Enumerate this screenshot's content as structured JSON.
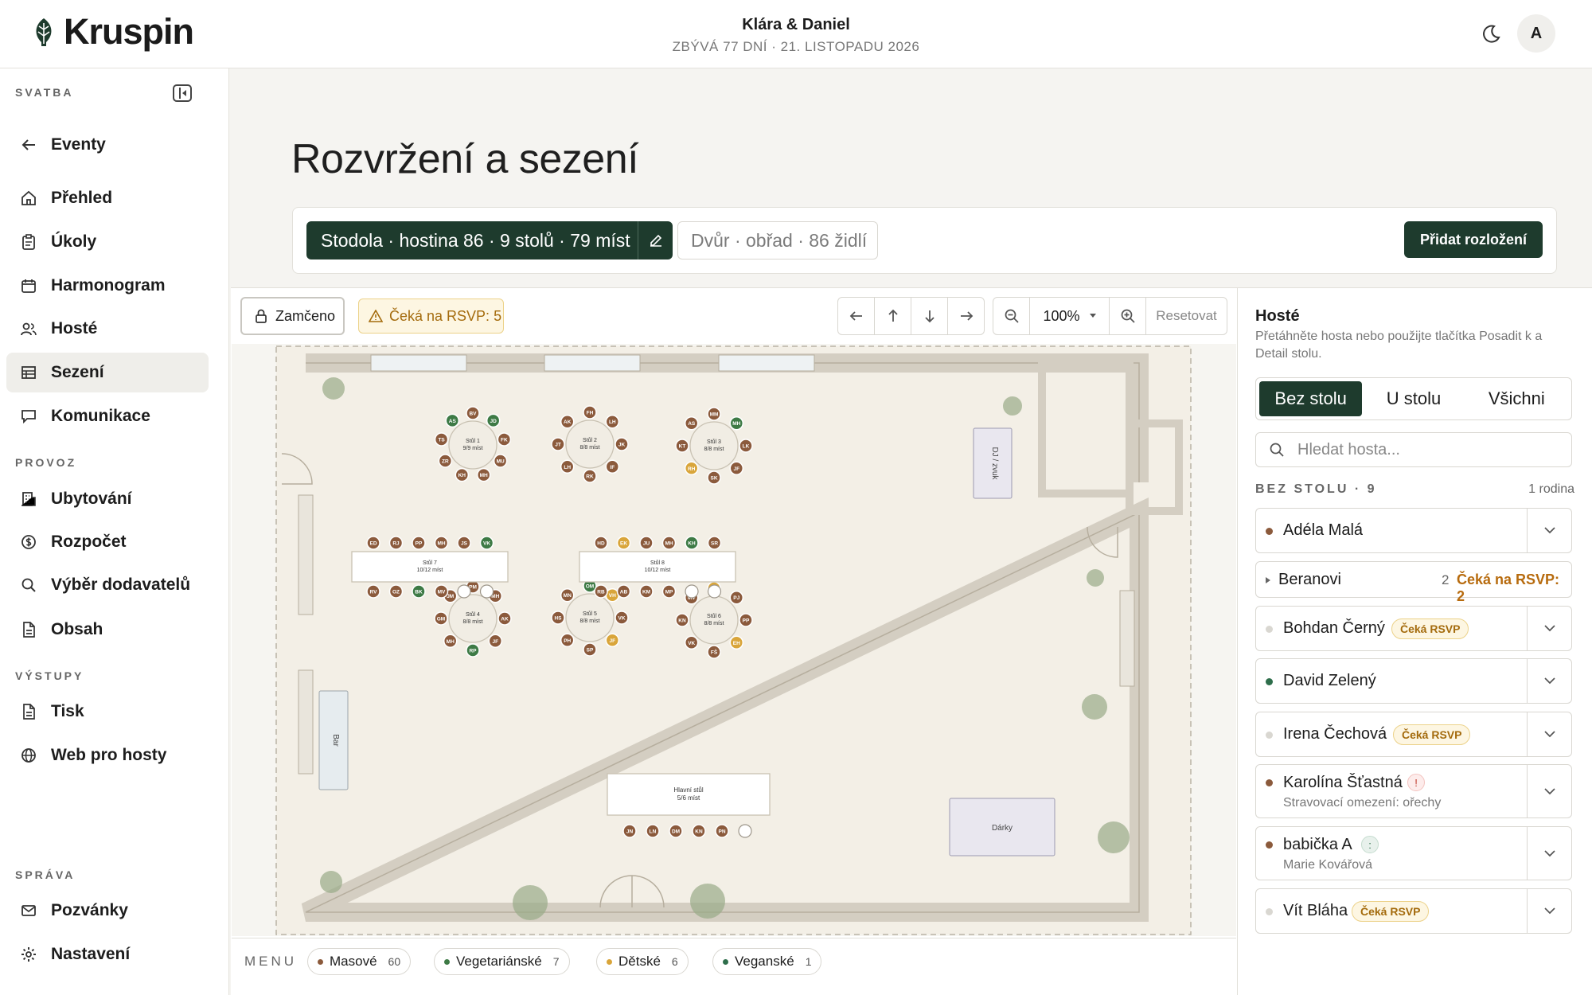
{
  "app": {
    "name": "Kruspin"
  },
  "header": {
    "couple": "Klára & Daniel",
    "countdown": "ZBÝVÁ 77 DNÍ · 21. LISTOPADU 2026",
    "avatar": "A"
  },
  "sidebar": {
    "sections": {
      "svatba": "SVATBA",
      "provoz": "PROVOZ",
      "vystupy": "VÝSTUPY",
      "sprava": "SPRÁVA"
    },
    "items": [
      {
        "label": "Eventy",
        "icon": "arrow-left-icon"
      },
      {
        "label": "Přehled",
        "icon": "home-icon"
      },
      {
        "label": "Úkoly",
        "icon": "clipboard-icon"
      },
      {
        "label": "Harmonogram",
        "icon": "calendar-icon"
      },
      {
        "label": "Hosté",
        "icon": "users-icon"
      },
      {
        "label": "Sezení",
        "icon": "table-icon",
        "active": true
      },
      {
        "label": "Komunikace",
        "icon": "chat-icon"
      },
      {
        "label": "Ubytování",
        "icon": "building-icon"
      },
      {
        "label": "Rozpočet",
        "icon": "coin-icon"
      },
      {
        "label": "Výběr dodavatelů",
        "icon": "search-icon"
      },
      {
        "label": "Obsah",
        "icon": "document-icon"
      },
      {
        "label": "Tisk",
        "icon": "print-icon"
      },
      {
        "label": "Web pro hosty",
        "icon": "globe-icon"
      },
      {
        "label": "Pozvánky",
        "icon": "mail-icon"
      },
      {
        "label": "Nastavení",
        "icon": "gear-icon"
      }
    ]
  },
  "page": {
    "title": "Rozvržení a sezení"
  },
  "layouts": {
    "active": "Stodola · hostina 86 · 9 stolů · 79 míst",
    "other": "Dvůr · obřad · 86 židlí",
    "add_label": "Přidat rozložení"
  },
  "toolbar": {
    "lock_label": "Zamčeno",
    "rsvp_warning": "Čeká na RSVP: 5",
    "zoom": "100%",
    "reset": "Resetovat"
  },
  "floorplan": {
    "colors": {
      "brown": "#8b5a3c",
      "green": "#3d7a45",
      "amber": "#d9a53a"
    },
    "round_tables": [
      {
        "name": "Stůl 1",
        "seats": "9/9 míst",
        "guests": [
          [
            "BV",
            "b"
          ],
          [
            "JD",
            "g"
          ],
          [
            "FK",
            "b"
          ],
          [
            "MU",
            "b"
          ],
          [
            "MH",
            "b"
          ],
          [
            "KH",
            "b"
          ],
          [
            "ZR",
            "b"
          ],
          [
            "TS",
            "b"
          ],
          [
            "AS",
            "g"
          ]
        ]
      },
      {
        "name": "Stůl 2",
        "seats": "8/8 míst",
        "guests": [
          [
            "FH",
            "b"
          ],
          [
            "LH",
            "b"
          ],
          [
            "JK",
            "b"
          ],
          [
            "IF",
            "b"
          ],
          [
            "RK",
            "b"
          ],
          [
            "LH",
            "b"
          ],
          [
            "JT",
            "b"
          ],
          [
            "AK",
            "b"
          ]
        ]
      },
      {
        "name": "Stůl 3",
        "seats": "8/8 míst",
        "guests": [
          [
            "MM",
            "b"
          ],
          [
            "MH",
            "g"
          ],
          [
            "LK",
            "b"
          ],
          [
            "JF",
            "b"
          ],
          [
            "SK",
            "b"
          ],
          [
            "RH",
            "a"
          ],
          [
            "KT",
            "b"
          ],
          [
            "AS",
            "b"
          ]
        ]
      },
      {
        "name": "Stůl 4",
        "seats": "8/8 míst",
        "guests": [
          [
            "PM",
            "b"
          ],
          [
            "MH",
            "b"
          ],
          [
            "AK",
            "b"
          ],
          [
            "JF",
            "b"
          ],
          [
            "RP",
            "g"
          ],
          [
            "MH",
            "b"
          ],
          [
            "GM",
            "b"
          ],
          [
            "JM",
            "b"
          ]
        ]
      },
      {
        "name": "Stůl 5",
        "seats": "8/8 míst",
        "guests": [
          [
            "OM",
            "g"
          ],
          [
            "VH",
            "a"
          ],
          [
            "VK",
            "b"
          ],
          [
            "JF",
            "a"
          ],
          [
            "SP",
            "b"
          ],
          [
            "PH",
            "b"
          ],
          [
            "HS",
            "b"
          ],
          [
            "MN",
            "b"
          ]
        ]
      },
      {
        "name": "Stůl 6",
        "seats": "8/8 míst",
        "guests": [
          [
            "BD",
            "a"
          ],
          [
            "PJ",
            "b"
          ],
          [
            "PP",
            "b"
          ],
          [
            "EH",
            "a"
          ],
          [
            "FŠ",
            "b"
          ],
          [
            "VK",
            "b"
          ],
          [
            "KN",
            "b"
          ],
          [
            "MV",
            "b"
          ]
        ]
      }
    ],
    "rect_tables": [
      {
        "name": "Stůl 7",
        "seats": "10/12 míst",
        "top": [
          [
            "ED",
            "b"
          ],
          [
            "RJ",
            "b"
          ],
          [
            "PP",
            "b"
          ],
          [
            "MH",
            "b"
          ],
          [
            "JS",
            "b"
          ],
          [
            "VK",
            "g"
          ]
        ],
        "bottom": [
          [
            "RV",
            "b"
          ],
          [
            "OZ",
            "b"
          ],
          [
            "BK",
            "g"
          ],
          [
            "MV",
            "b"
          ],
          [
            "",
            ""
          ],
          [
            "",
            ""
          ]
        ]
      },
      {
        "name": "Stůl 8",
        "seats": "10/12 míst",
        "top": [
          [
            "HD",
            "b"
          ],
          [
            "EK",
            "a"
          ],
          [
            "JU",
            "b"
          ],
          [
            "MH",
            "b"
          ],
          [
            "KH",
            "g"
          ],
          [
            "SR",
            "b"
          ]
        ],
        "bottom": [
          [
            "RB",
            "b"
          ],
          [
            "AB",
            "b"
          ],
          [
            "KM",
            "b"
          ],
          [
            "MP",
            "b"
          ],
          [
            "",
            ""
          ],
          [
            "",
            ""
          ]
        ]
      }
    ],
    "head_table": {
      "name": "Hlavní stůl",
      "seats": "5/6 míst",
      "guests": [
        [
          "JN",
          "b"
        ],
        [
          "LN",
          "b"
        ],
        [
          "DM",
          "b"
        ],
        [
          "KN",
          "b"
        ],
        [
          "PN",
          "b"
        ],
        [
          "",
          ""
        ]
      ]
    },
    "labels": {
      "dj": "DJ / zvuk",
      "bar": "Bar",
      "gifts": "Dárky"
    }
  },
  "menu": {
    "label": "MENU",
    "items": [
      {
        "name": "Masové",
        "count": "60",
        "color": "#8b5a3c"
      },
      {
        "name": "Vegetariánské",
        "count": "7",
        "color": "#3d7a45"
      },
      {
        "name": "Dětské",
        "count": "6",
        "color": "#d9a53a"
      },
      {
        "name": "Veganské",
        "count": "1",
        "color": "#2e6e4b"
      }
    ]
  },
  "guests_panel": {
    "title": "Hosté",
    "subtitle": "Přetáhněte hosta nebo použijte tlačítka Posadit k a Detail stolu.",
    "tabs": [
      "Bez stolu",
      "U stolu",
      "Všichni"
    ],
    "search_placeholder": "Hledat hosta...",
    "unseated_heading": "BEZ STOLU · 9",
    "families": "1 rodina",
    "guests": [
      {
        "name": "Adéla Malá",
        "dot": "#8b5a3c"
      },
      {
        "name": "Beranovi",
        "count": "2",
        "status": "Čeká na RSVP: 2"
      },
      {
        "name": "Bohdan Černý",
        "dot": "#d9d7d1",
        "badge": "Čeká RSVP"
      },
      {
        "name": "David Zelený",
        "dot": "#2e6e4b"
      },
      {
        "name": "Irena Čechová",
        "dot": "#d9d7d1",
        "badge": "Čeká RSVP"
      },
      {
        "name": "Karolína Šťastná",
        "dot": "#8b5a3c",
        "alert": "!",
        "note": "Stravovací omezení: ořechy"
      },
      {
        "name": "babička A",
        "dot": "#8b5a3c",
        "alert": ":",
        "note": "Marie Kovářová"
      },
      {
        "name": "Vít Bláha",
        "dot": "#d9d7d1",
        "badge": "Čeká RSVP"
      }
    ]
  }
}
